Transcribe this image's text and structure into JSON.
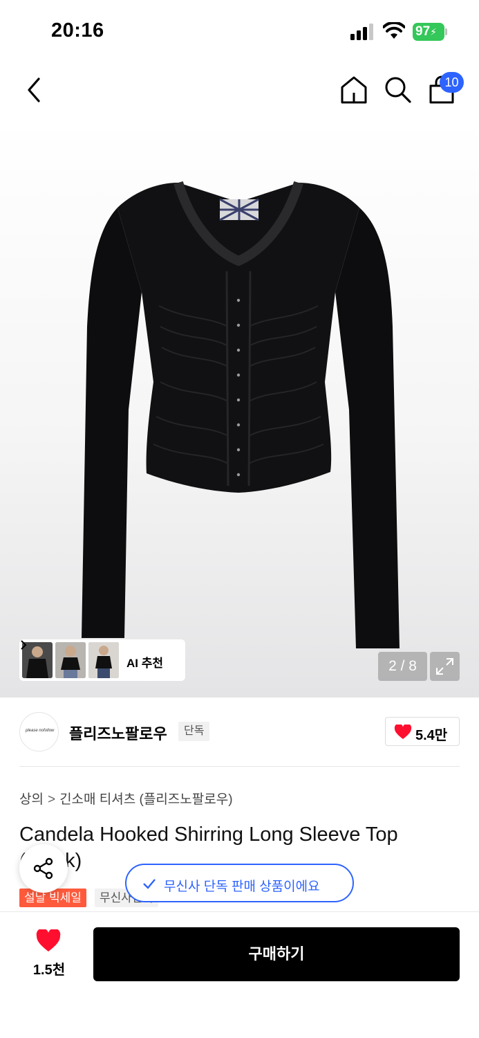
{
  "status_bar": {
    "time": "20:16",
    "battery": "97"
  },
  "header": {
    "cart_count": "10"
  },
  "gallery": {
    "ai_recommend_label": "AI 추천",
    "page_indicator": "2 / 8"
  },
  "brand": {
    "name": "플리즈노팔로우",
    "exclusive_tag": "단독",
    "like_count": "5.4만"
  },
  "product": {
    "breadcrumb": [
      "상의",
      "긴소매 티셔츠 (플리즈노팔로우)"
    ],
    "title": "Candela Hooked Shirring Long Sleeve Top (Black)",
    "sale_badge": "설날 빅세일",
    "partial_tag": "무신사단독"
  },
  "toast": {
    "message": "무신사 단독 판매 상품이에요"
  },
  "bottom_bar": {
    "wish_count": "1.5천",
    "buy_label": "구매하기"
  },
  "colors": {
    "accent": "#2d63ff",
    "sale": "#ff5a3c",
    "heart": "#ff0f2f",
    "battery": "#34c759"
  }
}
